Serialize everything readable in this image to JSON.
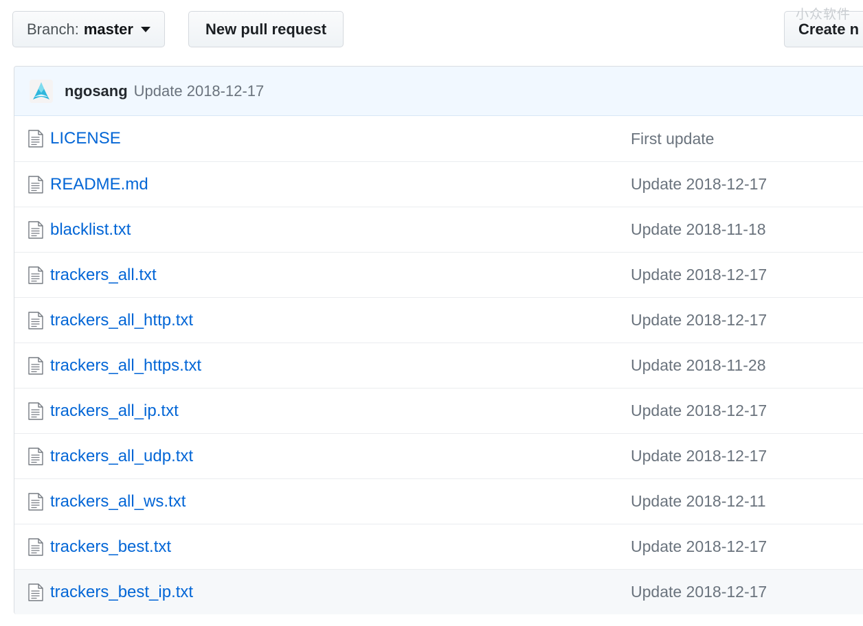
{
  "toolbar": {
    "branch_prefix": "Branch:",
    "branch_name": "master",
    "new_pull_request_label": "New pull request",
    "create_new_file_label": "Create n",
    "watermark": "小众软件"
  },
  "commit_header": {
    "author": "ngosang",
    "message": "Update 2018-12-17",
    "avatar_icon": "arch-logo-avatar"
  },
  "colors": {
    "link": "#0366d6",
    "muted_text": "#6a737d",
    "header_background": "#f1f8ff",
    "row_highlight": "#f6f8fa",
    "border": "#eaecef",
    "avatar_accent": "#2fb7dd"
  },
  "file_list": {
    "columns": [
      "name",
      "message"
    ],
    "rows": [
      {
        "icon": "file-icon",
        "name": "LICENSE",
        "message": "First update",
        "highlighted": false
      },
      {
        "icon": "file-icon",
        "name": "README.md",
        "message": "Update 2018-12-17",
        "highlighted": false
      },
      {
        "icon": "file-icon",
        "name": "blacklist.txt",
        "message": "Update 2018-11-18",
        "highlighted": false
      },
      {
        "icon": "file-icon",
        "name": "trackers_all.txt",
        "message": "Update 2018-12-17",
        "highlighted": false
      },
      {
        "icon": "file-icon",
        "name": "trackers_all_http.txt",
        "message": "Update 2018-12-17",
        "highlighted": false
      },
      {
        "icon": "file-icon",
        "name": "trackers_all_https.txt",
        "message": "Update 2018-11-28",
        "highlighted": false
      },
      {
        "icon": "file-icon",
        "name": "trackers_all_ip.txt",
        "message": "Update 2018-12-17",
        "highlighted": false
      },
      {
        "icon": "file-icon",
        "name": "trackers_all_udp.txt",
        "message": "Update 2018-12-17",
        "highlighted": false
      },
      {
        "icon": "file-icon",
        "name": "trackers_all_ws.txt",
        "message": "Update 2018-12-11",
        "highlighted": false
      },
      {
        "icon": "file-icon",
        "name": "trackers_best.txt",
        "message": "Update 2018-12-17",
        "highlighted": false
      },
      {
        "icon": "file-icon",
        "name": "trackers_best_ip.txt",
        "message": "Update 2018-12-17",
        "highlighted": true
      }
    ]
  }
}
